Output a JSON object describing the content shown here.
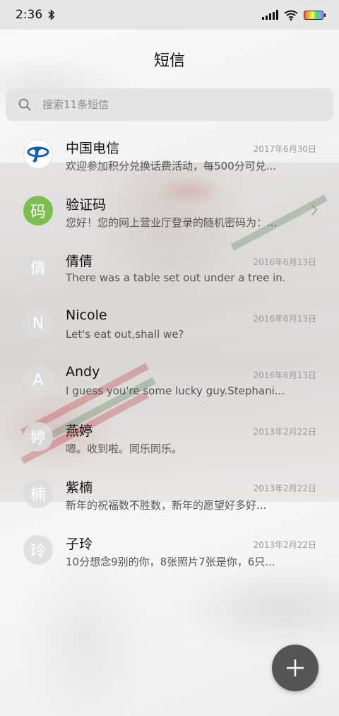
{
  "status": {
    "time": "2:36"
  },
  "header": {
    "title": "短信"
  },
  "search": {
    "placeholder": "搜索11条短信"
  },
  "conversations": [
    {
      "name": "中国电信",
      "date": "2017年6月30日",
      "preview": "欢迎参加积分兑换话费活动，每500分可兑...",
      "avatar": "telecom-logo"
    },
    {
      "name": "验证码",
      "date": "",
      "preview": "您好！您的网上营业厅登录的随机密码为：...",
      "avatar_text": "码"
    },
    {
      "name": "倩倩",
      "date": "2016年6月13日",
      "preview": "There was a table set out under a tree in...",
      "avatar_text": "倩"
    },
    {
      "name": "Nicole",
      "date": "2016年6月13日",
      "preview": "Let's eat out,shall we?",
      "avatar_text": "N"
    },
    {
      "name": "Andy",
      "date": "2016年6月13日",
      "preview": "I guess you're some lucky guy.Stephani...",
      "avatar_text": "A"
    },
    {
      "name": "燕婷",
      "date": "2013年2月22日",
      "preview": "嗯。收到啦。同乐同乐。",
      "avatar_text": "婷"
    },
    {
      "name": "紫楠",
      "date": "2013年2月22日",
      "preview": "新年的祝福数不胜数，新年的愿望好多好...",
      "avatar_text": "楠"
    },
    {
      "name": "子玲",
      "date": "2013年2月22日",
      "preview": "10分想念9别的你，8张照片7张是你，6只...",
      "avatar_text": "玲"
    }
  ],
  "colors": {
    "verification_avatar": "#7cbf4e",
    "fab": "#555555"
  }
}
